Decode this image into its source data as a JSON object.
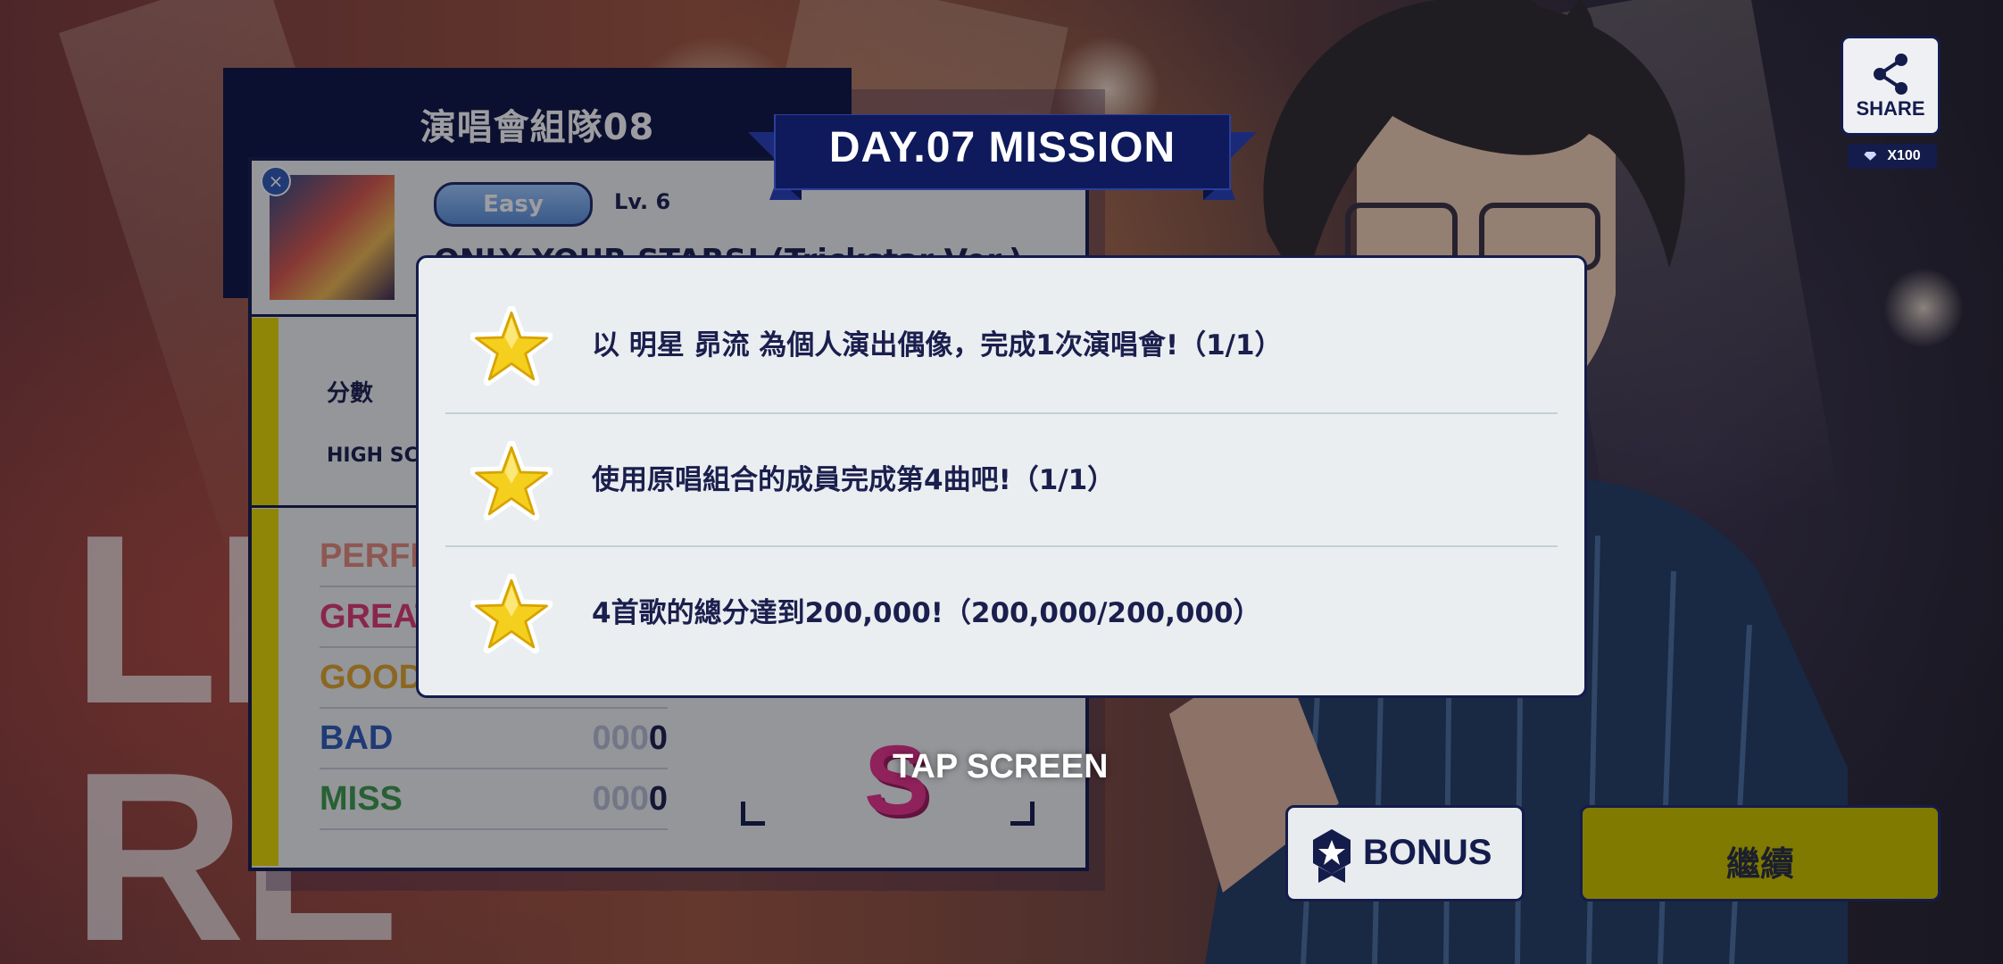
{
  "background": {
    "text_line1": "LI",
    "text_line2": "RE"
  },
  "result": {
    "team_name": "演唱會組隊08",
    "difficulty": "Easy",
    "level": "Lv. 6",
    "song_title": "ONLY YOUR STARS! (Trickstar Ver.)",
    "score_label": "分數",
    "high_score_label": "HIGH SCORE",
    "judgements": [
      {
        "name": "PERFECT",
        "color": "#e88a7a",
        "pad": "",
        "value": ""
      },
      {
        "name": "GREAT",
        "color": "#e0396f",
        "pad": "",
        "value": ""
      },
      {
        "name": "GOOD",
        "color": "#e2a52c",
        "pad": "",
        "value": ""
      },
      {
        "name": "BAD",
        "color": "#2f5ab8",
        "pad": "000",
        "value": "0"
      },
      {
        "name": "MISS",
        "color": "#3d9a48",
        "pad": "000",
        "value": "0"
      }
    ],
    "rank": "S"
  },
  "share": {
    "label": "SHARE",
    "reward": "X100",
    "icon": "share-icon"
  },
  "mission": {
    "title": "DAY.07 MISSION",
    "items": [
      {
        "text": "以 明星 昴流 為個人演出偶像，完成1次演唱會!（1/1）"
      },
      {
        "text": "使用原唱組合的成員完成第4曲吧!（1/1）"
      },
      {
        "text": "4首歌的總分達到200,000!（200,000/200,000）"
      }
    ]
  },
  "tap_screen": "TAP SCREEN",
  "buttons": {
    "bonus": "BONUS",
    "continue": "繼續"
  },
  "colors": {
    "navy": "#141c4c",
    "yellow": "#e8d900",
    "continue_bg": "#807a00"
  }
}
